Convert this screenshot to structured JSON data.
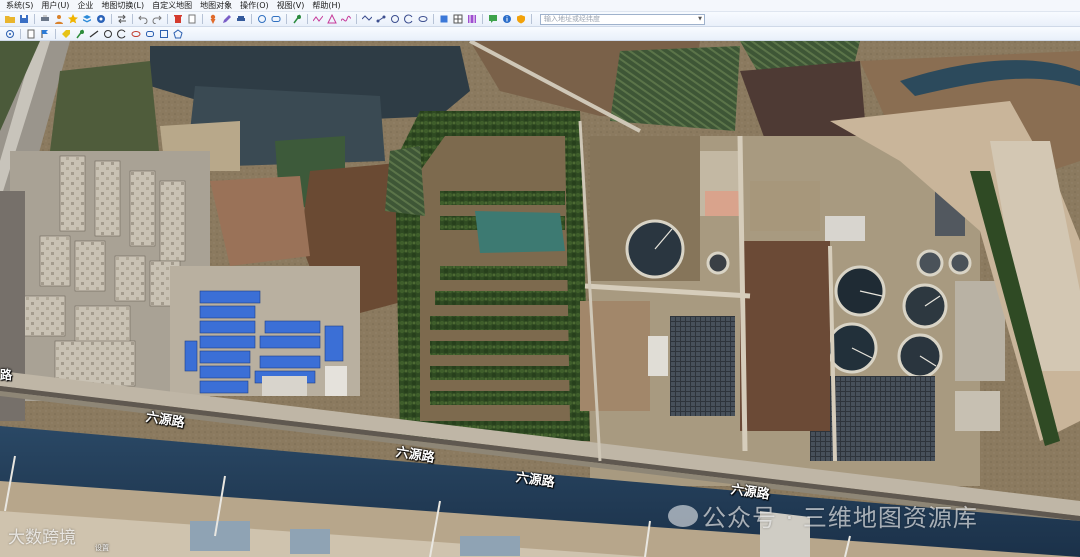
{
  "menubar": {
    "items": [
      "系统(S)",
      "用户(U)",
      "企业",
      "地图切换(L)",
      "自定义地图",
      "地图对象",
      "操作(O)",
      "视图(V)",
      "帮助(H)"
    ]
  },
  "toolbar": {
    "search_placeholder": "输入地址或经纬度"
  },
  "map": {
    "road_labels": [
      "六源路",
      "六源路",
      "六源路",
      "六源路"
    ],
    "edge_label": "路",
    "watermark_text": "公众号 · 三维地图资源库",
    "watermark_left": "大数跨境",
    "small_label": "设置"
  },
  "colors": {
    "menubar_bg": "#f4f7fc",
    "toolbar_bg": "#e9f0fa",
    "river": "#1f3d5c",
    "blue_roofs": "#3b6fd6"
  },
  "icons": {
    "toolbar1": [
      "folder-icon",
      "save-icon",
      "print-icon",
      "user-icon",
      "star-icon",
      "layers-icon",
      "eye-icon",
      "arrows-icon",
      "undo-icon",
      "redo-icon",
      "delete-icon",
      "page-icon",
      "person-pin-icon",
      "pen-icon",
      "car-icon",
      "circle-icon",
      "rect-icon",
      "pin-icon",
      "polyline-icon",
      "triangle-icon",
      "curve-icon",
      "measure-icon",
      "route-icon",
      "circle-tool-icon",
      "arc-icon",
      "ellipse-icon",
      "box-icon",
      "grid-icon",
      "film-icon",
      "chat-icon",
      "info-icon",
      "shield-icon"
    ],
    "toolbar2": [
      "target-icon",
      "doc-icon",
      "flag-icon",
      "tag-icon",
      "marker-icon",
      "line-icon",
      "circle-draw-icon",
      "arc-draw-icon",
      "ellipse-draw-icon",
      "rect-draw-icon",
      "square-draw-icon",
      "polygon-draw-icon"
    ]
  }
}
